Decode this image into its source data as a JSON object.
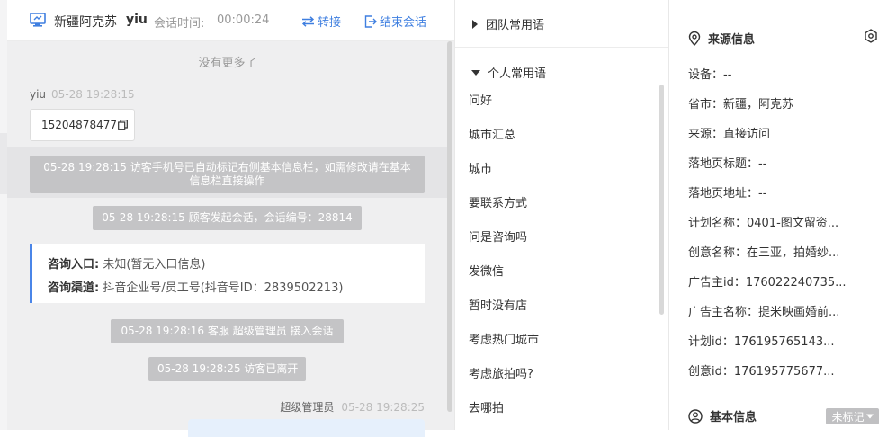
{
  "header": {
    "visitor_name": "新疆阿克苏",
    "agent_name": "yiu",
    "session_label": "会话时间:",
    "session_time": "00:00:24",
    "transfer_label": "转接",
    "end_label": "结束会话"
  },
  "chat": {
    "no_more": "没有更多了",
    "visitor_sender": "yiu",
    "visitor_time": "05-28 19:28:15",
    "phone_number": "15204878477",
    "system_notice_1": "05-28 19:28:15 访客手机号已自动标记右侧基本信息栏，如需修改请在基本信息栏直接操作",
    "system_notice_2": "05-28 19:28:15 顾客发起会话，会话编号：28814",
    "consult_entry_label": "咨询入口:",
    "consult_entry_value": "未知(暂无入口信息)",
    "consult_channel_label": "咨询渠道:",
    "consult_channel_value": "抖音企业号/员工号(抖音号ID：2839502213)",
    "system_notice_3": "05-28 19:28:16 客服 超级管理员 接入会话",
    "system_notice_4": "05-28 19:28:25 访客已离开",
    "agent_sender": "超级管理员",
    "agent_time": "05-28 19:28:25"
  },
  "phrases": {
    "team_group": "团队常用语",
    "personal_group": "个人常用语",
    "items": [
      "问好",
      "城市汇总",
      "城市",
      "要联系方式",
      "问是咨询吗",
      "发微信",
      "暂时没有店",
      "考虑热门城市",
      "考虑旅拍吗?",
      "去哪拍"
    ]
  },
  "source_info": {
    "title": "来源信息",
    "fields": [
      "设备：--",
      "省市：新疆，阿克苏",
      "来源：直接访问",
      "落地页标题：--",
      "落地页地址：--",
      "计划名称：0401-图文留资...",
      "创意名称：在三亚，拍婚纱...",
      "广告主id：176022240735...",
      "广告主名称：提米映画婚前...",
      "计划id：176195765143...",
      "创意id：176195775677..."
    ],
    "basic_info_title": "基本信息",
    "unmarked_label": "未标记"
  },
  "colors": {
    "accent": "#3f7fe0",
    "card_border": "#4a85e8",
    "system_pill": "#c4c4c6"
  },
  "icons": {
    "monitor": "monitor-icon",
    "transfer": "swap-arrows-icon",
    "end": "exit-icon",
    "copy": "copy-icon",
    "location": "location-pin-icon",
    "settings": "hexagon-settings-icon",
    "user": "user-circle-icon"
  }
}
